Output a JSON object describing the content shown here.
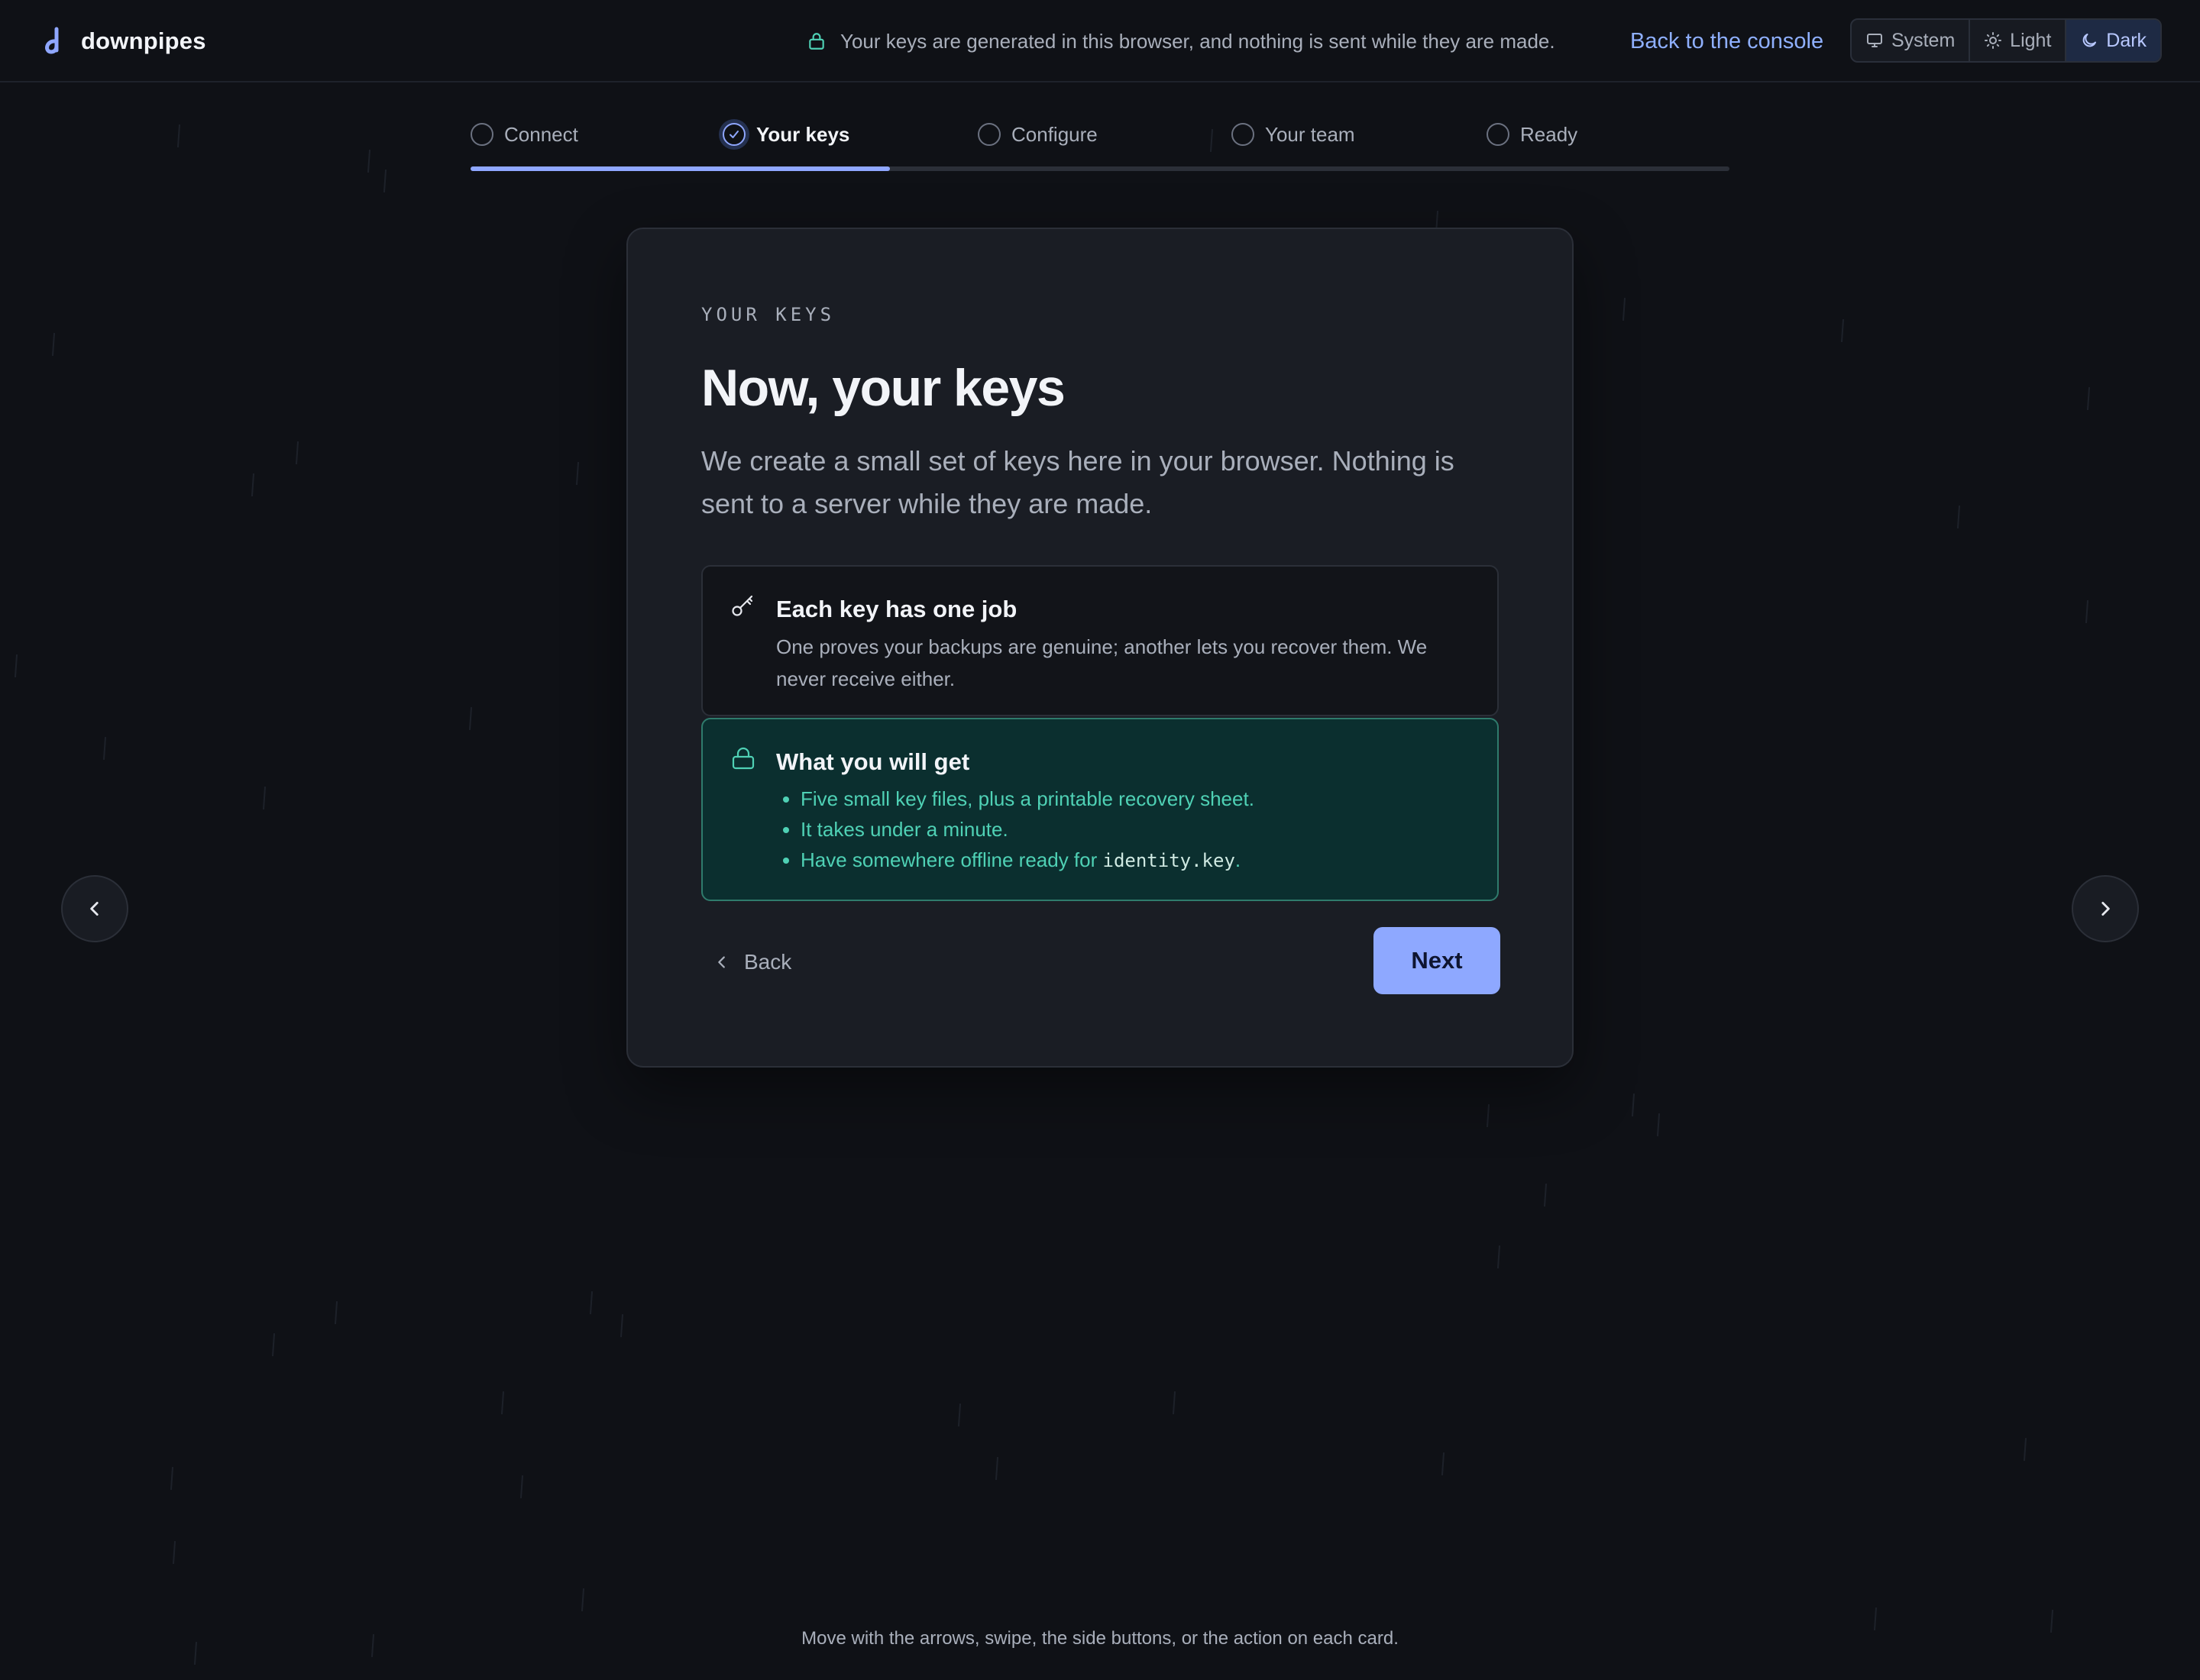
{
  "brand": {
    "name": "downpipes",
    "logo_icon": "downpipes-logo-icon",
    "accent": "#8fa7ff"
  },
  "header": {
    "privacy_icon": "lock-icon",
    "privacy_note": "Your keys are generated in this browser, and nothing is sent while they are made.",
    "console_link": "Back to the console",
    "theme": {
      "options": [
        {
          "label": "System",
          "icon": "monitor-icon"
        },
        {
          "label": "Light",
          "icon": "sun-icon"
        },
        {
          "label": "Dark",
          "icon": "moon-icon"
        }
      ],
      "selected": "Dark"
    }
  },
  "stepper": {
    "steps": [
      {
        "label": "Connect",
        "state": "pending"
      },
      {
        "label": "Your keys",
        "state": "current"
      },
      {
        "label": "Configure",
        "state": "pending"
      },
      {
        "label": "Your team",
        "state": "pending"
      },
      {
        "label": "Ready",
        "state": "pending"
      }
    ],
    "progress": 0.333
  },
  "card": {
    "eyebrow": "YOUR KEYS",
    "title": "Now, your keys",
    "lead": "We create a small set of keys here in your browser. Nothing is sent to a server while they are made.",
    "info_panel": {
      "icon": "key-icon",
      "title": "Each key has one job",
      "text": "One proves your backups are genuine; another lets you recover them. We never receive either."
    },
    "get_panel": {
      "icon": "lock-icon",
      "title": "What you will get",
      "items": [
        "Five small key files, plus a printable recovery sheet.",
        "It takes under a minute.",
        "Have somewhere offline ready for "
      ],
      "filename": "identity.key",
      "trailing": "."
    },
    "back_label": "Back",
    "next_label": "Next"
  },
  "colors": {
    "background": "#0f1116",
    "card": "#1a1d24",
    "success_bg": "#0b2f2f",
    "success_text": "#4fd1b5",
    "primary_button": "#8ea8ff"
  },
  "footer": {
    "hint": "Move with the arrows, swipe, the side buttons, or the action on each card."
  }
}
